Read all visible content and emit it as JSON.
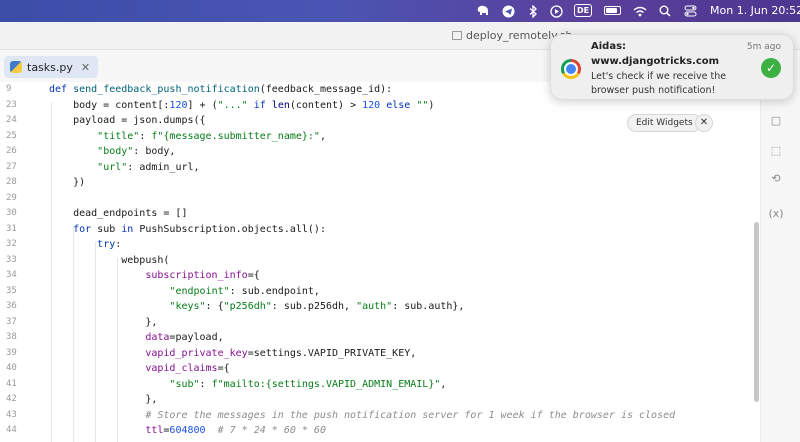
{
  "menubar": {
    "input_source": "DE",
    "clock": "Mon 1. Jun  20:52",
    "icons": [
      "elephant-icon",
      "telegram-icon",
      "bluetooth-icon",
      "play-circle-icon",
      "input-source-icon",
      "battery-icon",
      "wifi-icon",
      "spotlight-search-icon",
      "control-center-icon"
    ]
  },
  "editor": {
    "background_tab": "deploy_remotely.sh",
    "active_tab": "tasks.py",
    "lines": [
      {
        "n": "9",
        "code": "def send_feedback_push_notification(feedback_message_id):"
      },
      {
        "n": "23",
        "code": "    body = content[:120] + (\"...\" if len(content) > 120 else \"\")"
      },
      {
        "n": "24",
        "code": "    payload = json.dumps({"
      },
      {
        "n": "25",
        "code": "        \"title\": f\"{message.submitter_name}:\","
      },
      {
        "n": "26",
        "code": "        \"body\": body,"
      },
      {
        "n": "27",
        "code": "        \"url\": admin_url,"
      },
      {
        "n": "28",
        "code": "    })"
      },
      {
        "n": "29",
        "code": ""
      },
      {
        "n": "30",
        "code": "    dead_endpoints = []"
      },
      {
        "n": "31",
        "code": "    for sub in PushSubscription.objects.all():"
      },
      {
        "n": "32",
        "code": "        try:"
      },
      {
        "n": "33",
        "code": "            webpush("
      },
      {
        "n": "34",
        "code": "                subscription_info={"
      },
      {
        "n": "35",
        "code": "                    \"endpoint\": sub.endpoint,"
      },
      {
        "n": "36",
        "code": "                    \"keys\": {\"p256dh\": sub.p256dh, \"auth\": sub.auth},"
      },
      {
        "n": "37",
        "code": "                },"
      },
      {
        "n": "38",
        "code": "                data=payload,"
      },
      {
        "n": "39",
        "code": "                vapid_private_key=settings.VAPID_PRIVATE_KEY,"
      },
      {
        "n": "40",
        "code": "                vapid_claims={"
      },
      {
        "n": "41",
        "code": "                    \"sub\": f\"mailto:{settings.VAPID_ADMIN_EMAIL}\","
      },
      {
        "n": "42",
        "code": "                },"
      },
      {
        "n": "43",
        "code": "                # Store the messages in the push notification server for 1 week if the browser is closed"
      },
      {
        "n": "44",
        "code": "                ttl=604800  # 7 * 24 * 60 * 60"
      }
    ]
  },
  "notification": {
    "app": "Aidas:",
    "time": "5m ago",
    "title": "www.djangotricks.com",
    "body": "Let's check if we receive the browser push notification!",
    "edit_widgets": "Edit Widgets",
    "close": "✕"
  }
}
